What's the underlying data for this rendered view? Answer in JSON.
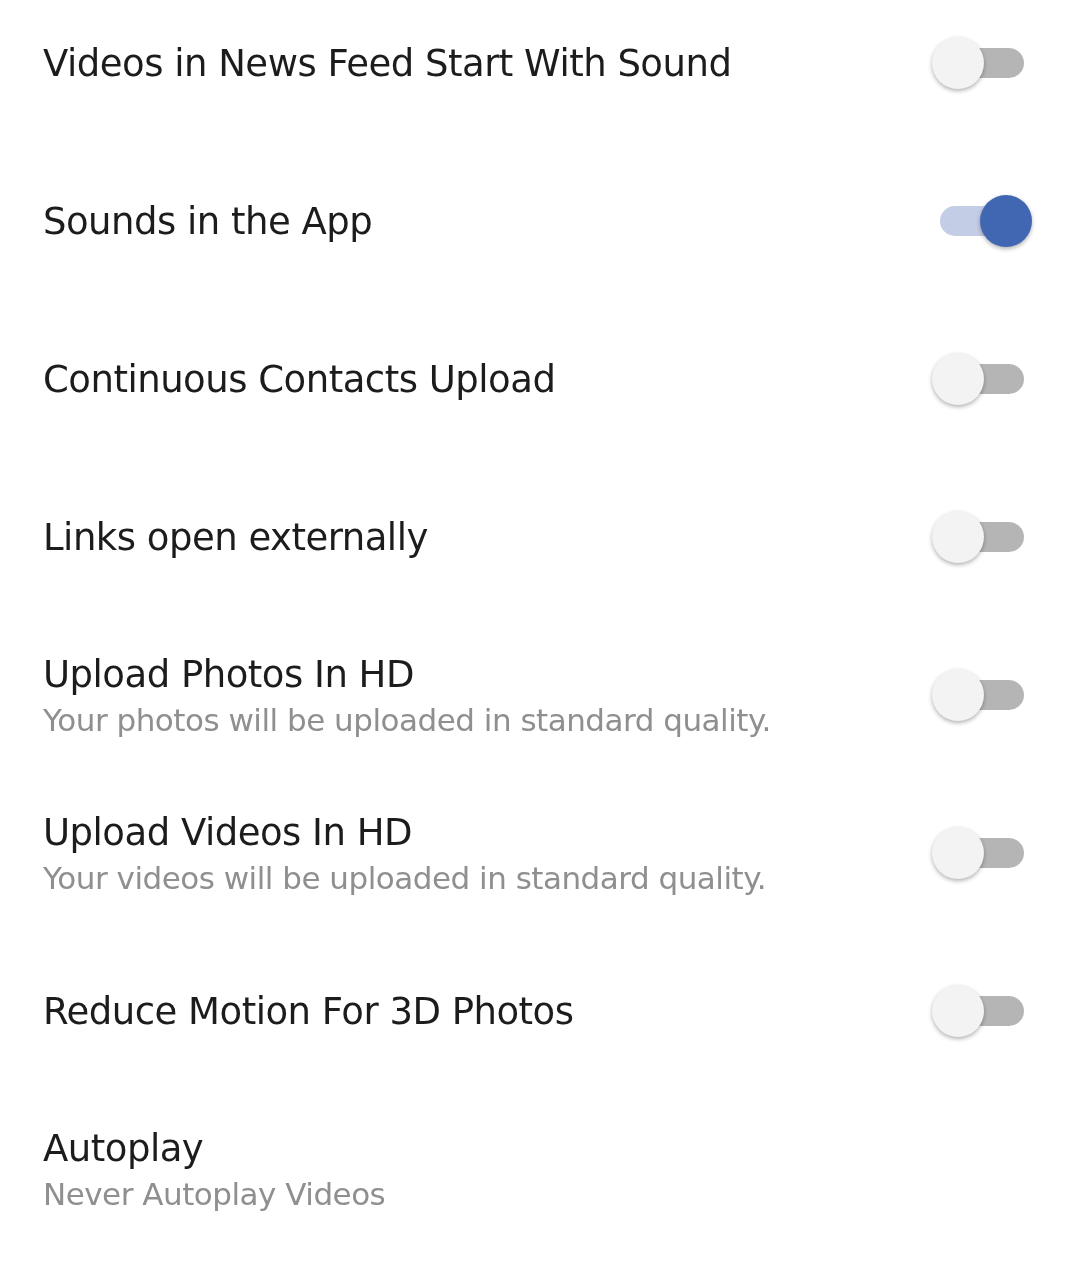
{
  "settings": [
    {
      "kind": "toggle",
      "title": "Videos in News Feed Start With Sound",
      "on": false
    },
    {
      "kind": "toggle",
      "title": "Sounds in the App",
      "on": true
    },
    {
      "kind": "toggle",
      "title": "Continuous Contacts Upload",
      "on": false
    },
    {
      "kind": "toggle",
      "title": "Links open externally",
      "on": false
    },
    {
      "kind": "toggle",
      "title": "Upload Photos In HD",
      "subtitle": "Your photos will be uploaded in standard quality.",
      "on": false
    },
    {
      "kind": "toggle",
      "title": "Upload Videos In HD",
      "subtitle": "Your videos will be uploaded in standard quality.",
      "on": false
    },
    {
      "kind": "toggle",
      "title": "Reduce Motion For 3D Photos",
      "on": false
    },
    {
      "kind": "option",
      "title": "Autoplay",
      "subtitle": "Never Autoplay Videos"
    }
  ]
}
